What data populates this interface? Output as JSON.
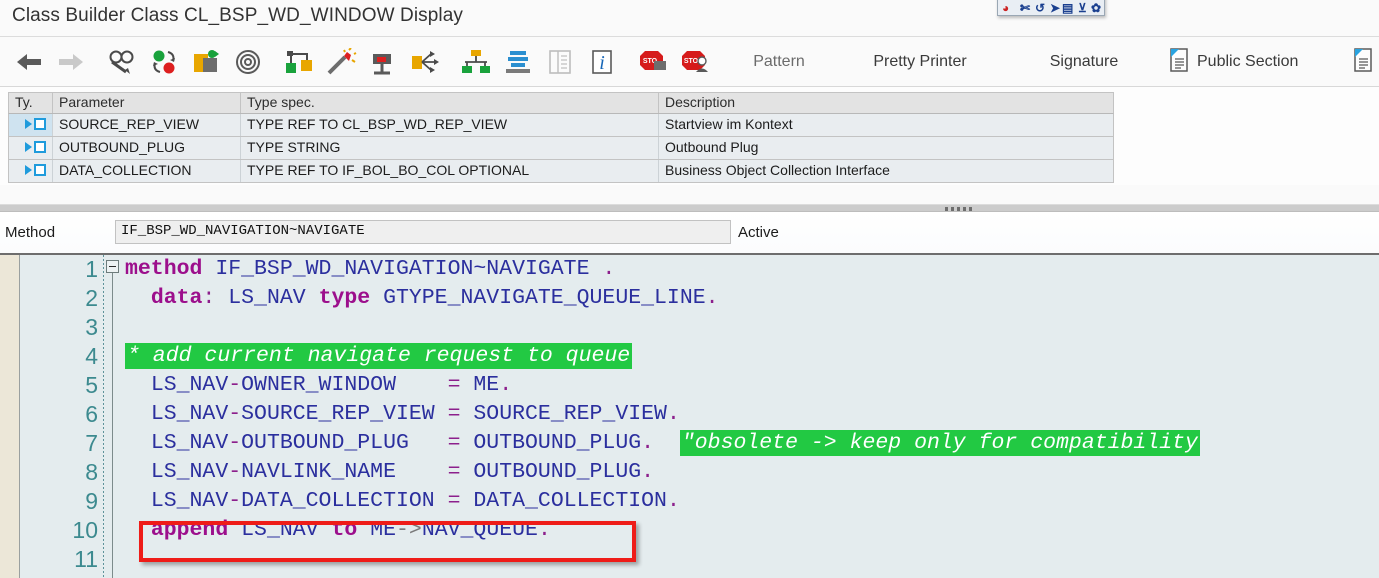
{
  "window": {
    "title": "Class Builder  Class CL_BSP_WD_WINDOW  Display"
  },
  "float_toolbar": {
    "name": "floating-mini-toolbar",
    "icons": [
      "globe-icon",
      "scissors-icon",
      "undo-icon",
      "arrow-icon",
      "keyboard-icon",
      "cursor-icon",
      "settings-icon"
    ]
  },
  "toolbar": {
    "icons": [
      {
        "name": "back-arrow-icon",
        "glyph": "back"
      },
      {
        "name": "forward-arrow-icon",
        "glyph": "forward"
      },
      {
        "name": "display-change-icon",
        "glyph": "glasses-pencil"
      },
      {
        "name": "check-activate-icon",
        "glyph": "green-red-circles"
      },
      {
        "name": "copy-icon",
        "glyph": "copy-pages"
      },
      {
        "name": "pattern-spiral-icon",
        "glyph": "spiral"
      },
      {
        "name": "where-used-list-icon",
        "glyph": "where-used"
      },
      {
        "name": "generate-icon",
        "glyph": "magic-wand"
      },
      {
        "name": "breakpoint-icon",
        "glyph": "stop-flag"
      },
      {
        "name": "navigate-icon",
        "glyph": "branch-out"
      },
      {
        "name": "class-hierarchy-icon",
        "glyph": "hierarchy"
      },
      {
        "name": "local-types-icon",
        "glyph": "stack-layers"
      },
      {
        "name": "documentation-icon",
        "glyph": "document-lines"
      },
      {
        "name": "info-icon",
        "glyph": "info-i"
      },
      {
        "name": "external-breakpoint-icon",
        "glyph": "stop-monitor"
      },
      {
        "name": "session-breakpoint-icon",
        "glyph": "stop-person"
      }
    ],
    "pattern_label": "Pattern",
    "pretty_printer_label": "Pretty Printer",
    "signature_label": "Signature",
    "public_section_label": "Public Section",
    "public_section_icon": "section-document-icon",
    "last_section_icon": "section-document-icon"
  },
  "parameter_table": {
    "columns": [
      "Ty.",
      "Parameter",
      "Type spec.",
      "Description"
    ],
    "rows": [
      {
        "type_icon": "importing-parameter-icon",
        "selected": true,
        "parameter": "SOURCE_REP_VIEW",
        "type_spec": "TYPE REF TO CL_BSP_WD_REP_VIEW",
        "description": "Startview im Kontext"
      },
      {
        "type_icon": "importing-parameter-icon",
        "selected": false,
        "parameter": "OUTBOUND_PLUG",
        "type_spec": "TYPE STRING",
        "description": "Outbound Plug"
      },
      {
        "type_icon": "importing-parameter-icon",
        "selected": false,
        "parameter": "DATA_COLLECTION",
        "type_spec": "TYPE REF TO IF_BOL_BO_COL OPTIONAL",
        "description": "Business Object Collection Interface"
      }
    ]
  },
  "method_bar": {
    "label": "Method",
    "value": "IF_BSP_WD_NAVIGATION~NAVIGATE",
    "status": "Active"
  },
  "editor": {
    "line_numbers": [
      "1",
      "2",
      "3",
      "4",
      "5",
      "6",
      "7",
      "8",
      "9",
      "10",
      "11"
    ],
    "lines": [
      {
        "n": 1,
        "text": "method IF_BSP_WD_NAVIGATION~NAVIGATE ."
      },
      {
        "n": 2,
        "text": "  data: LS_NAV type GTYPE_NAVIGATE_QUEUE_LINE."
      },
      {
        "n": 3,
        "text": ""
      },
      {
        "n": 4,
        "text": "* add current navigate request to queue"
      },
      {
        "n": 5,
        "text": "  LS_NAV-OWNER_WINDOW     = ME."
      },
      {
        "n": 6,
        "text": "  LS_NAV-SOURCE_REP_VIEW = SOURCE_REP_VIEW."
      },
      {
        "n": 7,
        "text": "  LS_NAV-OUTBOUND_PLUG   = OUTBOUND_PLUG.   \"obsolete -> keep only for compatibility"
      },
      {
        "n": 8,
        "text": "  LS_NAV-NAVLINK_NAME    = OUTBOUND_PLUG."
      },
      {
        "n": 9,
        "text": "  LS_NAV-DATA_COLLECTION = DATA_COLLECTION."
      },
      {
        "n": 10,
        "text": "  append LS_NAV to ME->NAV_QUEUE."
      },
      {
        "n": 11,
        "text": ""
      }
    ],
    "highlighted_comments": [
      "* add current navigate request to queue",
      "\"obsolete -> keep only for compatibility"
    ],
    "annotation_box_line": "10",
    "annotation_box_color": "#ee1c18"
  },
  "colors": {
    "comment_highlight_bg": "#22c943",
    "keyword": "#9c0f8c",
    "identifier": "#2b2f9e",
    "editor_bg": "#e4ecee",
    "line_number": "#3c8a8f",
    "annotation_red": "#ee1c18"
  }
}
